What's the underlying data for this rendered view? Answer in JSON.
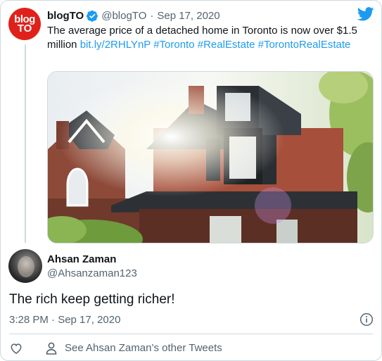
{
  "original_tweet": {
    "avatar_text_line1": "blog",
    "avatar_text_line2": "TO",
    "display_name": "blogTO",
    "handle": "@blogTO",
    "separator": "·",
    "date": "Sep 17, 2020",
    "text": "The average price of a detached home in Toronto is now over $1.5 million",
    "link": "bit.ly/2RHLYnP",
    "hashtags": [
      "#Toronto",
      "#RealEstate",
      "#TorontoRealEstate"
    ]
  },
  "reply_tweet": {
    "display_name": "Ahsan Zaman",
    "handle": "@Ahsanzaman123",
    "text": "The rich keep getting richer!",
    "timestamp": "3:28 PM · Sep 17, 2020"
  },
  "footer": {
    "other_tweets_label": "See Ahsan Zaman’s other Tweets"
  },
  "colors": {
    "link_blue": "#1d9bf0",
    "muted_gray": "#536471",
    "border": "#cfd9de",
    "blogto_red": "#e0211b"
  },
  "icons": [
    "twitter-bird-icon",
    "verified-badge-icon",
    "info-icon",
    "heart-icon",
    "person-icon"
  ]
}
